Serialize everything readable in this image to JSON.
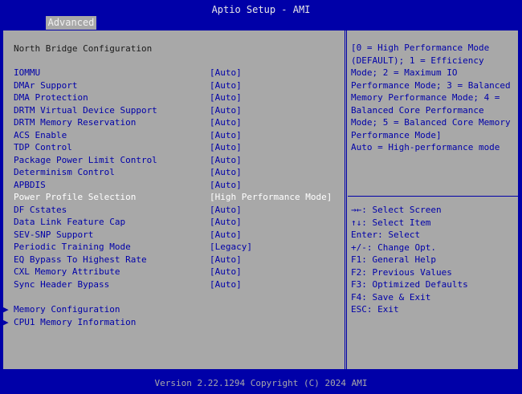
{
  "header": {
    "title": "Aptio Setup - AMI",
    "tabs": [
      {
        "label": "Advanced",
        "active": true
      }
    ]
  },
  "section_title": "North Bridge Configuration",
  "settings": [
    {
      "label": "IOMMU",
      "value": "[Auto]"
    },
    {
      "label": "DMAr Support",
      "value": "[Auto]"
    },
    {
      "label": "DMA Protection",
      "value": "[Auto]"
    },
    {
      "label": "DRTM Virtual Device Support",
      "value": "[Auto]"
    },
    {
      "label": "DRTM Memory Reservation",
      "value": "[Auto]"
    },
    {
      "label": "ACS Enable",
      "value": "[Auto]"
    },
    {
      "label": "TDP Control",
      "value": "[Auto]"
    },
    {
      "label": "Package Power Limit Control",
      "value": "[Auto]"
    },
    {
      "label": "Determinism Control",
      "value": "[Auto]"
    },
    {
      "label": "APBDIS",
      "value": "[Auto]"
    },
    {
      "label": "Power Profile Selection",
      "value": "[High Performance Mode]",
      "selected": true
    },
    {
      "label": "DF Cstates",
      "value": "[Auto]"
    },
    {
      "label": "Data Link Feature Cap",
      "value": "[Auto]"
    },
    {
      "label": "SEV-SNP Support",
      "value": "[Auto]"
    },
    {
      "label": "Periodic Training Mode",
      "value": "[Legacy]"
    },
    {
      "label": "EQ Bypass To Highest Rate",
      "value": "[Auto]"
    },
    {
      "label": "CXL Memory Attribute",
      "value": "[Auto]"
    },
    {
      "label": "Sync Header Bypass",
      "value": "[Auto]"
    }
  ],
  "submenus": [
    {
      "label": "Memory Configuration"
    },
    {
      "label": "CPU1 Memory Information"
    }
  ],
  "help": {
    "lines": [
      "[0 = High Performance Mode",
      "(DEFAULT); 1 = Efficiency",
      "Mode; 2 = Maximum IO",
      "Performance Mode; 3 = Balanced",
      "Memory Performance Mode; 4 =",
      "Balanced Core Performance",
      "Mode; 5 = Balanced Core Memory",
      "Performance Mode]",
      "Auto = High-performance mode"
    ]
  },
  "keys": [
    "→←: Select Screen",
    "↑↓: Select Item",
    "Enter: Select",
    "+/-: Change Opt.",
    "F1: General Help",
    "F2: Previous Values",
    "F3: Optimized Defaults",
    "F4: Save & Exit",
    "ESC: Exit"
  ],
  "footer": {
    "version": "Version 2.22.1294 Copyright (C) 2024 AMI"
  },
  "colors": {
    "frame_blue": "#0000a8",
    "panel_gray": "#a8a8a8",
    "selected_text": "#ffffff"
  }
}
